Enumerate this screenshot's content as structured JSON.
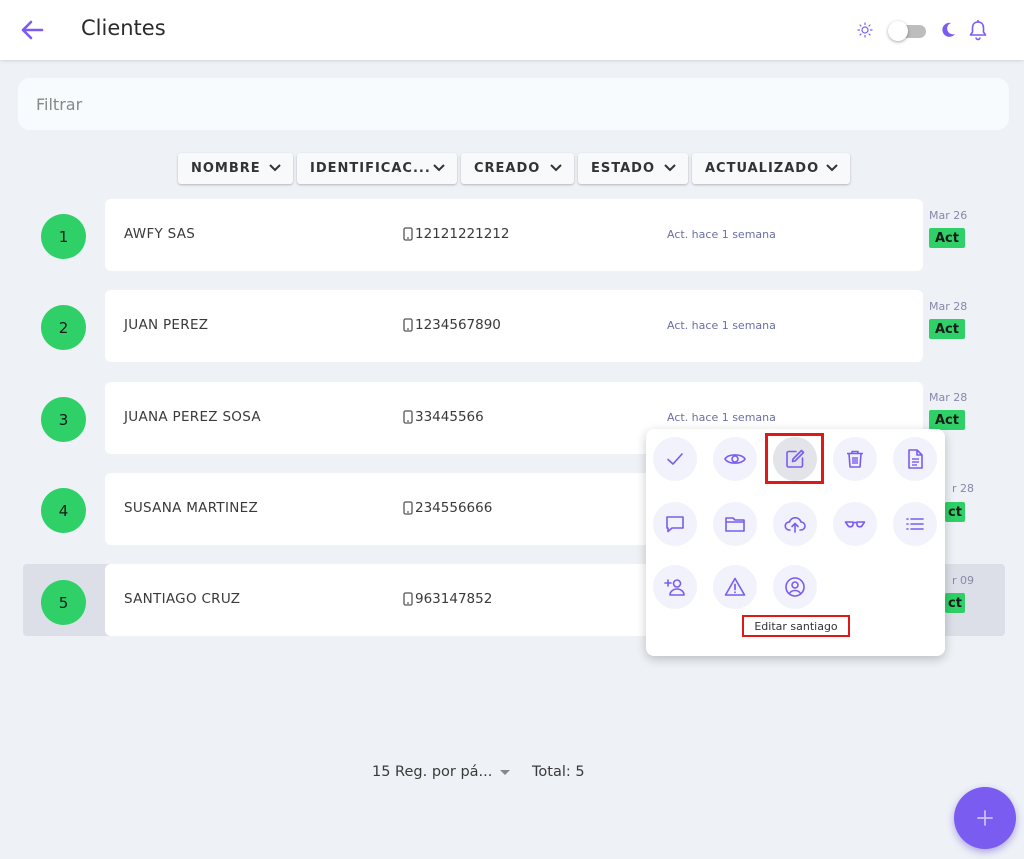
{
  "colors": {
    "accent": "#7b5cf0",
    "status_green": "#2ed067",
    "highlight_red": "#e01818"
  },
  "header": {
    "title": "Clientes",
    "back_icon": "arrow-left-icon",
    "theme_light_icon": "sun-icon",
    "theme_dark_icon": "moon-icon",
    "notifications_icon": "bell-icon"
  },
  "filter": {
    "placeholder": "Filtrar"
  },
  "sort_buttons": [
    {
      "label": "NOMBRE"
    },
    {
      "label": "IDENTIFICAC..."
    },
    {
      "label": "CREADO"
    },
    {
      "label": "ESTADO"
    },
    {
      "label": "ACTUALIZADO"
    }
  ],
  "clients": [
    {
      "index": "1",
      "name": "AWFY SAS",
      "id": "12121221212",
      "updated": "Act. hace 1 semana",
      "date": "Mar 26",
      "status": "Act"
    },
    {
      "index": "2",
      "name": "JUAN PEREZ",
      "id": "1234567890",
      "updated": "Act. hace 1 semana",
      "date": "Mar 28",
      "status": "Act"
    },
    {
      "index": "3",
      "name": "JUANA PEREZ SOSA",
      "id": "33445566",
      "updated": "Act. hace 1 semana",
      "date": "Mar 28",
      "status": "Act"
    },
    {
      "index": "4",
      "name": "SUSANA MARTINEZ",
      "id": "234556666",
      "updated": "",
      "date": "r 28",
      "status": "ct"
    },
    {
      "index": "5",
      "name": "SANTIAGO CRUZ",
      "id": "963147852",
      "updated": "",
      "date": "r 09",
      "status": "ct"
    }
  ],
  "actions_menu": {
    "items": [
      {
        "name": "check-icon"
      },
      {
        "name": "eye-icon"
      },
      {
        "name": "edit-icon"
      },
      {
        "name": "trash-icon"
      },
      {
        "name": "document-icon"
      },
      {
        "name": "chat-icon"
      },
      {
        "name": "folder-icon"
      },
      {
        "name": "cloud-upload-icon"
      },
      {
        "name": "glasses-icon"
      },
      {
        "name": "list-icon"
      },
      {
        "name": "add-user-icon"
      },
      {
        "name": "warning-icon"
      },
      {
        "name": "user-circle-icon"
      }
    ],
    "tooltip": "Editar santiago"
  },
  "pagination": {
    "per_page": "15 Reg. por pá...",
    "total": "Total: 5"
  },
  "fab_icon": "plus-icon"
}
